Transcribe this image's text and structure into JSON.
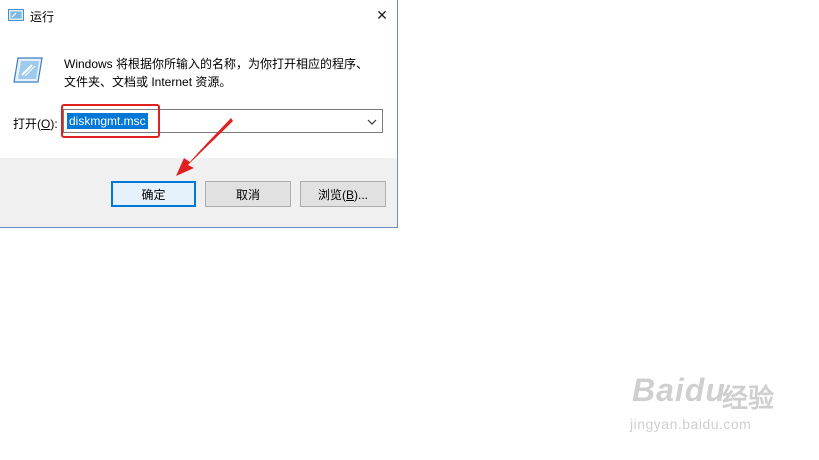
{
  "window": {
    "title": "运行",
    "close_symbol": "✕"
  },
  "description": {
    "line1": "Windows 将根据你所输入的名称，为你打开相应的程序、",
    "line2": "文件夹、文档或 Internet 资源。"
  },
  "open": {
    "label": "打开(",
    "mnemonic": "O",
    "label_end": "):",
    "value": "diskmgmt.msc"
  },
  "buttons": {
    "ok": "确定",
    "cancel": "取消",
    "browse": "浏览(",
    "browse_mnemonic": "B",
    "browse_end": ")..."
  },
  "watermark": {
    "brand": "Baidu",
    "cn": "经验",
    "url": "jingyan.baidu.com"
  },
  "colors": {
    "accent": "#0078d7",
    "annotation": "#e02020"
  }
}
